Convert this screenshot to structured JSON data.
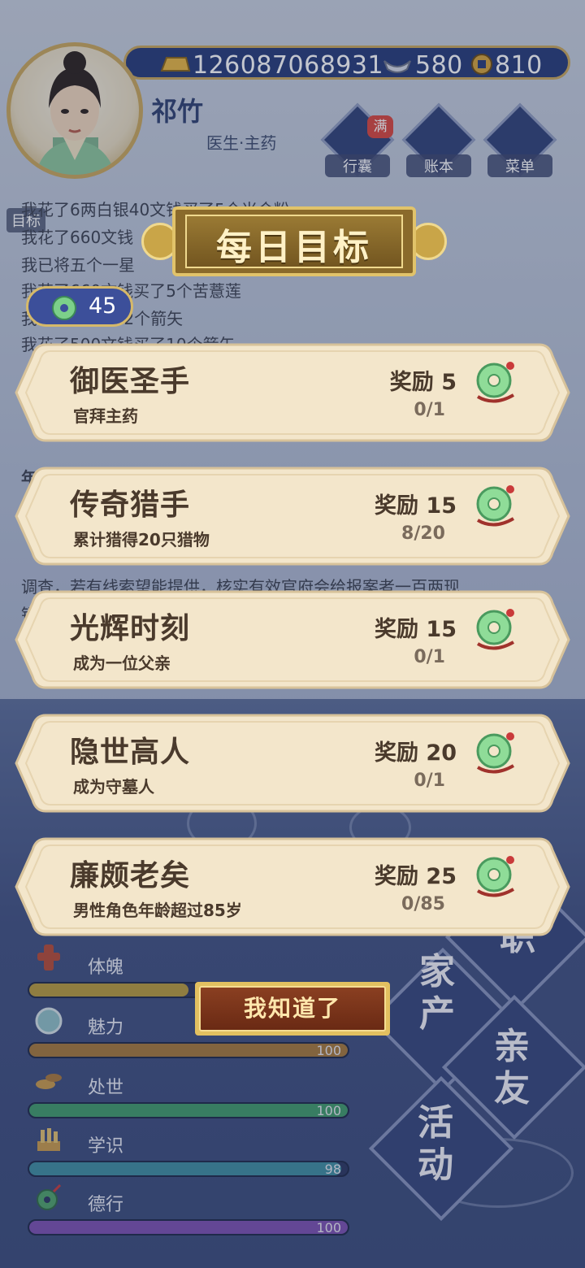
{
  "header": {
    "currency": {
      "gold": "126087068931",
      "silver": "580",
      "coin": "810"
    },
    "character": {
      "name": "祁竹",
      "title": "医生·主药"
    },
    "buttons": [
      {
        "label": "行囊",
        "icon": "bag-icon",
        "badge": "满"
      },
      {
        "label": "账本",
        "icon": "ledger-icon"
      },
      {
        "label": "菜单",
        "icon": "more-icon"
      }
    ]
  },
  "log": {
    "label": "目标",
    "lines": [
      "我花了6两白银40文钱买了5个米合粉",
      "我花了660文钱",
      "我已将五个一星",
      "我花了660文钱买了5个苦薏莲",
      "我花了   钱买了2个箭矢",
      "我花了500文钱买了10个箭矢"
    ],
    "partial": [
      "年",
      "调查，若有线索望能提供，核实有效官府会给报案者一百两现",
      "银"
    ]
  },
  "jade_counter": "45",
  "modal": {
    "title": "每日目标",
    "reward_label": "奖励",
    "goals": [
      {
        "title": "御医圣手",
        "desc": "官拜主药",
        "reward": "5",
        "progress": "0/1"
      },
      {
        "title": "传奇猎手",
        "desc": "累计猎得20只猎物",
        "reward": "15",
        "progress": "8/20"
      },
      {
        "title": "光辉时刻",
        "desc": "成为一位父亲",
        "reward": "15",
        "progress": "0/1"
      },
      {
        "title": "隐世高人",
        "desc": "成为守墓人",
        "reward": "20",
        "progress": "0/1"
      },
      {
        "title": "廉颇老矣",
        "desc": "男性角色年龄超过85岁",
        "reward": "25",
        "progress": "0/85"
      }
    ],
    "confirm_label": "我知道了"
  },
  "stats": [
    {
      "label": "体魄",
      "value": "",
      "fill": 0.5,
      "color": "#b89a3c"
    },
    {
      "label": "魅力",
      "value": "100",
      "fill": 1.0,
      "color": "#a5783a"
    },
    {
      "label": "处世",
      "value": "100",
      "fill": 1.0,
      "color": "#3f9a6a"
    },
    {
      "label": "学识",
      "value": "98",
      "fill": 0.98,
      "color": "#3d8da0"
    },
    {
      "label": "德行",
      "value": "100",
      "fill": 1.0,
      "color": "#7b4fb0"
    }
  ],
  "side_menu": {
    "items": [
      "职",
      "家产",
      "亲友",
      "活动"
    ]
  }
}
